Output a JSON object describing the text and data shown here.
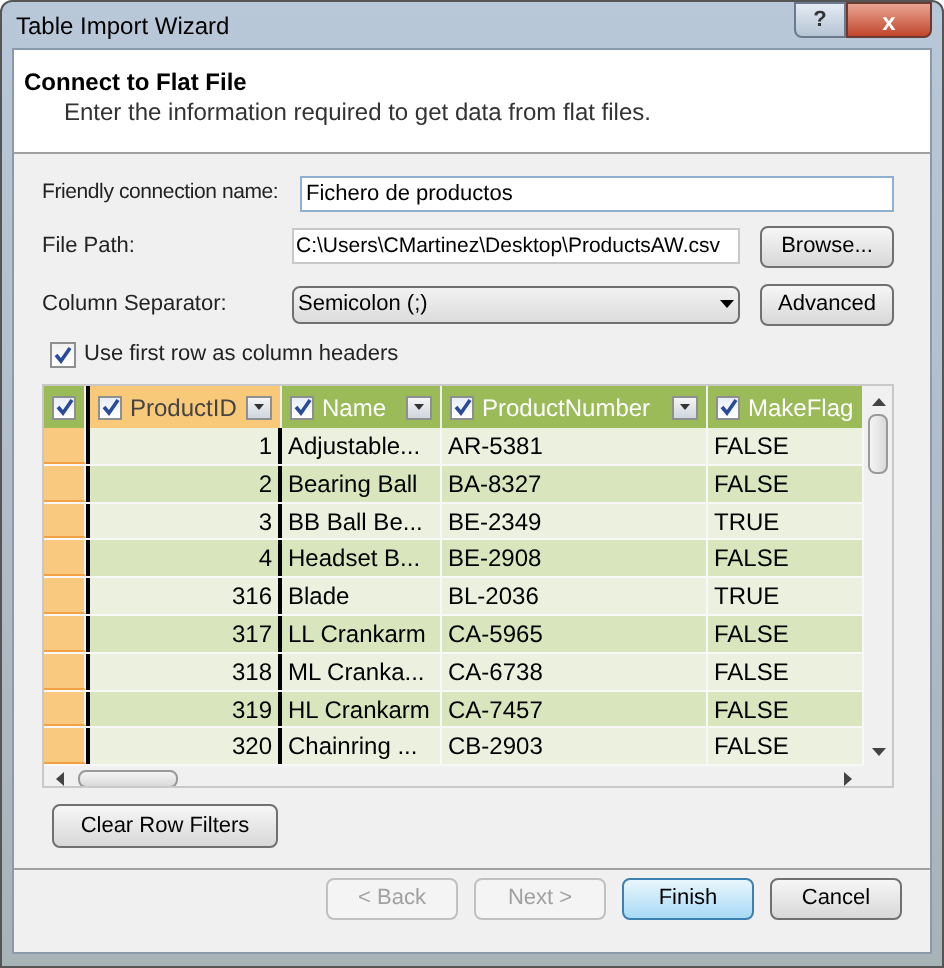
{
  "window": {
    "title": "Table Import Wizard",
    "help_glyph": "?",
    "close_glyph": "x"
  },
  "header": {
    "title": "Connect to Flat File",
    "subtitle": "Enter the information required to get data from flat files."
  },
  "form": {
    "friendly_name": {
      "label": "Friendly connection name:",
      "value": "Fichero de productos"
    },
    "file_path": {
      "label": "File Path:",
      "value": "C:\\Users\\CMartinez\\Desktop\\ProductsAW.csv",
      "button": "Browse..."
    },
    "separator": {
      "label": "Column Separator:",
      "value": "Semicolon (;)",
      "button": "Advanced"
    },
    "first_row_headers": {
      "label": "Use first row as column headers",
      "checked": true
    }
  },
  "table": {
    "all_checked": true,
    "columns": [
      {
        "label": "ProductID",
        "checked": true,
        "selected": true,
        "kind": "number"
      },
      {
        "label": "Name",
        "checked": true,
        "selected": false,
        "kind": "text"
      },
      {
        "label": "ProductNumber",
        "checked": true,
        "selected": false,
        "kind": "text"
      },
      {
        "label": "MakeFlag",
        "checked": true,
        "selected": false,
        "kind": "text"
      }
    ],
    "rows": [
      [
        "1",
        "Adjustable...",
        "AR-5381",
        "FALSE"
      ],
      [
        "2",
        "Bearing Ball",
        "BA-8327",
        "FALSE"
      ],
      [
        "3",
        "BB Ball Be...",
        "BE-2349",
        "TRUE"
      ],
      [
        "4",
        "Headset B...",
        "BE-2908",
        "FALSE"
      ],
      [
        "316",
        "Blade",
        "BL-2036",
        "TRUE"
      ],
      [
        "317",
        "LL Crankarm",
        "CA-5965",
        "FALSE"
      ],
      [
        "318",
        "ML Cranka...",
        "CA-6738",
        "FALSE"
      ],
      [
        "319",
        "HL Crankarm",
        "CA-7457",
        "FALSE"
      ],
      [
        "320",
        "Chainring ...",
        "CB-2903",
        "FALSE"
      ]
    ]
  },
  "clear_filters_button": "Clear Row Filters",
  "buttons": [
    {
      "label": "< Back",
      "disabled": true,
      "default": false
    },
    {
      "label": "Next >",
      "disabled": true,
      "default": false
    },
    {
      "label": "Finish",
      "disabled": false,
      "default": true
    },
    {
      "label": "Cancel",
      "disabled": false,
      "default": false
    }
  ]
}
